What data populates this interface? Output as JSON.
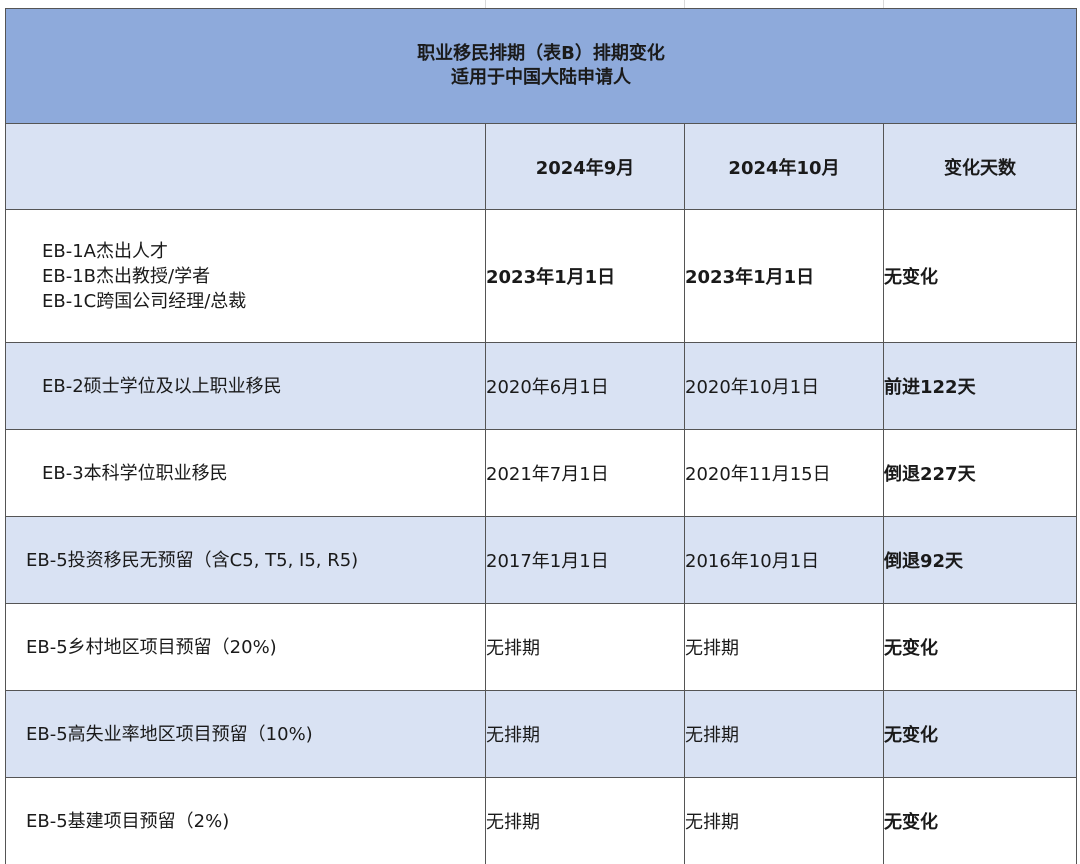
{
  "title": {
    "line1": "职业移民排期（表B）排期变化",
    "line2": "适用于中国大陆申请人"
  },
  "columns": {
    "category": "",
    "sep2024": "2024年9月",
    "oct2024": "2024年10月",
    "change": "变化天数"
  },
  "rows": [
    {
      "category_lines": [
        "EB-1A杰出人才",
        "EB-1B杰出教授/学者",
        "EB-1C跨国公司经理/总裁"
      ],
      "sep2024": "2023年1月1日",
      "oct2024": "2023年1月1日",
      "change": "无变化"
    },
    {
      "category_lines": [
        "EB-2硕士学位及以上职业移民"
      ],
      "sep2024": "2020年6月1日",
      "oct2024": "2020年10月1日",
      "change": "前进122天"
    },
    {
      "category_lines": [
        "EB-3本科学位职业移民"
      ],
      "sep2024": "2021年7月1日",
      "oct2024": "2020年11月15日",
      "change": "倒退227天"
    },
    {
      "category_lines": [
        "EB-5投资移民无预留（含C5, T5, I5, R5)"
      ],
      "sep2024": "2017年1月1日",
      "oct2024": "2016年10月1日",
      "change": "倒退92天"
    },
    {
      "category_lines": [
        "EB-5乡村地区项目预留（20%)"
      ],
      "sep2024": "无排期",
      "oct2024": "无排期",
      "change": "无变化"
    },
    {
      "category_lines": [
        "EB-5高失业率地区项目预留（10%)"
      ],
      "sep2024": "无排期",
      "oct2024": "无排期",
      "change": "无变化"
    },
    {
      "category_lines": [
        "EB-5基建项目预留（2%)"
      ],
      "sep2024": "无排期",
      "oct2024": "无排期",
      "change": "无变化"
    }
  ],
  "colors": {
    "title_background": "#8eaadb",
    "band_background": "#d9e2f3",
    "border": "#555555"
  }
}
